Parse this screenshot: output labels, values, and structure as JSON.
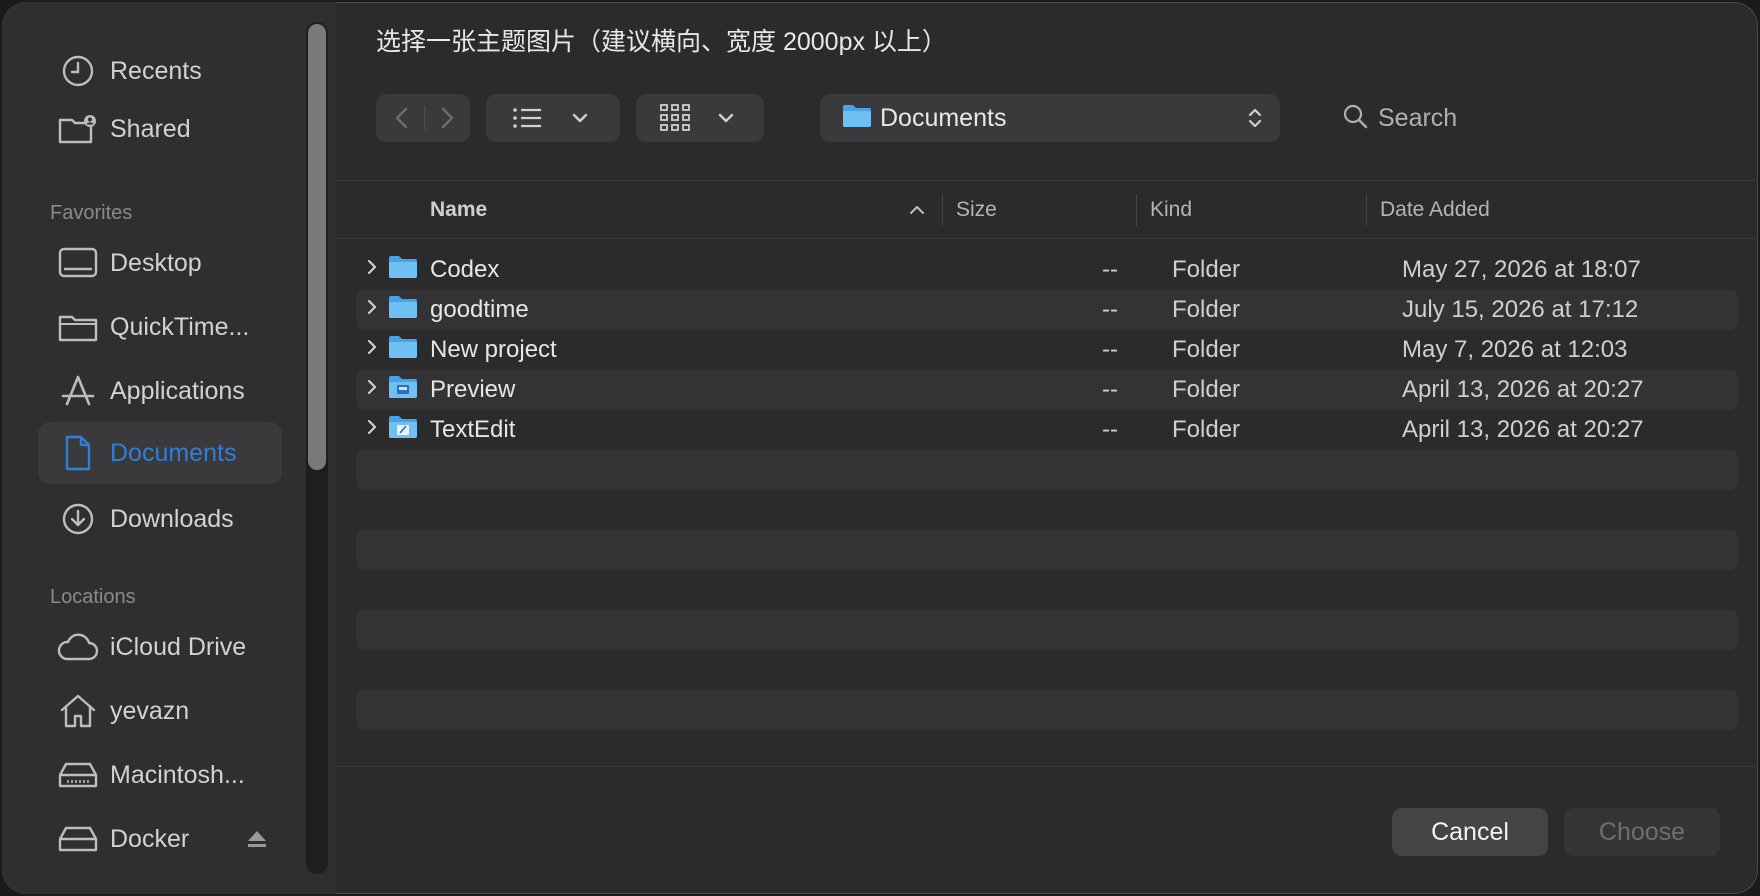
{
  "dialog": {
    "title": "选择一张主题图片（建议横向、宽度 2000px 以上）"
  },
  "sidebar": {
    "top_items": [
      {
        "label": "Recents",
        "icon": "clock-icon"
      },
      {
        "label": "Shared",
        "icon": "shared-folder-icon"
      }
    ],
    "favorites_header": "Favorites",
    "favorites": [
      {
        "label": "Desktop",
        "icon": "desktop-icon"
      },
      {
        "label": "QuickTime...",
        "icon": "folder-icon"
      },
      {
        "label": "Applications",
        "icon": "applications-icon"
      },
      {
        "label": "Documents",
        "icon": "document-icon",
        "selected": true
      },
      {
        "label": "Downloads",
        "icon": "download-icon"
      }
    ],
    "locations_header": "Locations",
    "locations": [
      {
        "label": "iCloud Drive",
        "icon": "cloud-icon"
      },
      {
        "label": "yevazn",
        "icon": "home-icon"
      },
      {
        "label": "Macintosh...",
        "icon": "disk-icon"
      },
      {
        "label": "Docker",
        "icon": "disk-icon"
      }
    ]
  },
  "toolbar": {
    "location": "Documents",
    "search_placeholder": "Search"
  },
  "columns": {
    "name": "Name",
    "size": "Size",
    "kind": "Kind",
    "date_added": "Date Added"
  },
  "files": [
    {
      "name": "Codex",
      "size": "--",
      "kind": "Folder",
      "date_added": "May 27, 2026 at 18:07"
    },
    {
      "name": "goodtime",
      "size": "--",
      "kind": "Folder",
      "date_added": "July 15, 2026 at 17:12"
    },
    {
      "name": "New project",
      "size": "--",
      "kind": "Folder",
      "date_added": "May 7, 2026 at 12:03"
    },
    {
      "name": "Preview",
      "size": "--",
      "kind": "Folder",
      "date_added": "April 13, 2026 at 20:27"
    },
    {
      "name": "TextEdit",
      "size": "--",
      "kind": "Folder",
      "date_added": "April 13, 2026 at 20:27"
    }
  ],
  "buttons": {
    "cancel": "Cancel",
    "choose": "Choose"
  },
  "colors": {
    "accent": "#2f7fd8",
    "folder": "#5fb4f0"
  }
}
